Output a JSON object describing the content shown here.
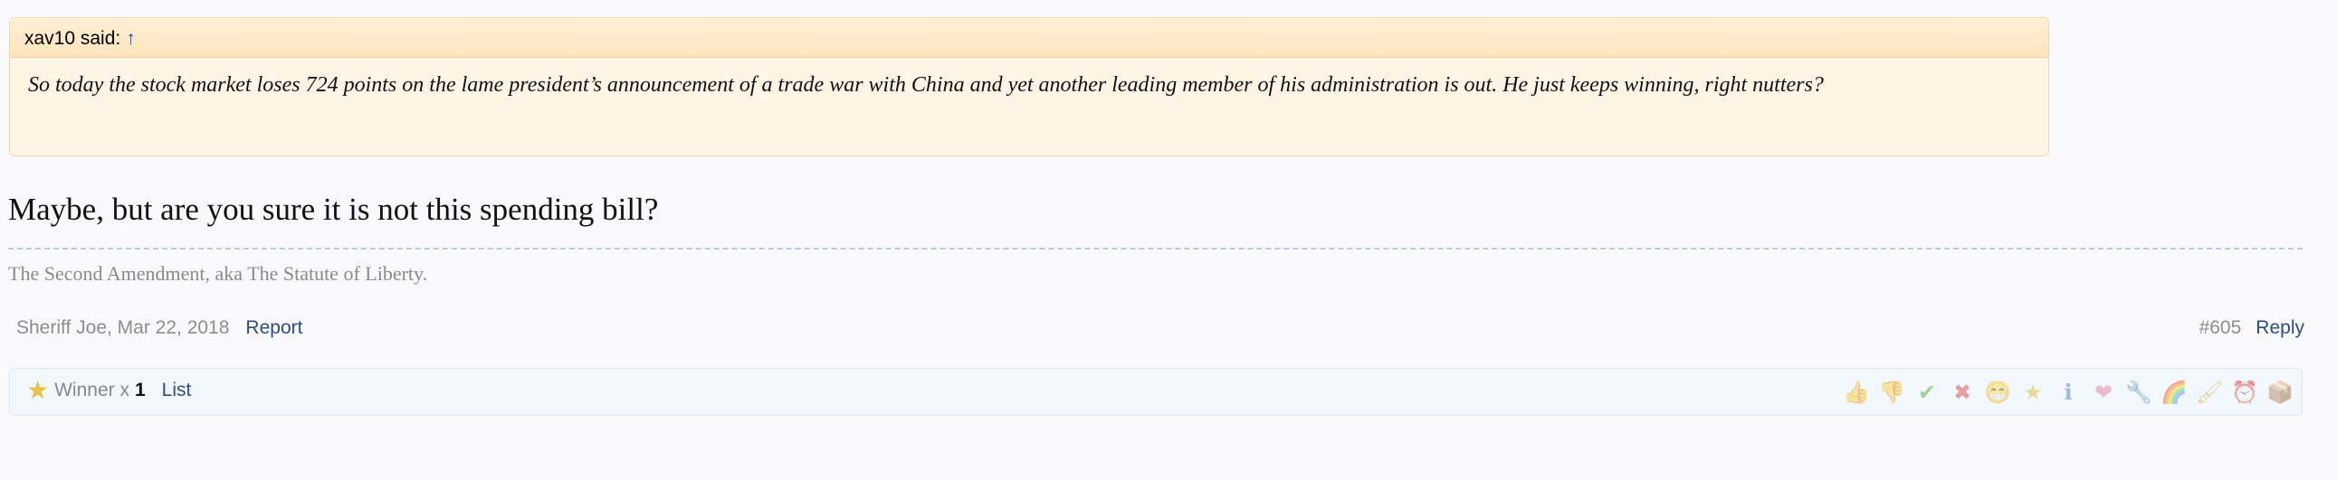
{
  "quote": {
    "author_label": "xav10 said:",
    "arrow": "↑",
    "text": "So today the stock market loses 724 points on the lame president’s announcement of a trade war with China and yet another leading member of his administration is out. He just keeps winning, right nutters?"
  },
  "post": {
    "body": "Maybe, but are you sure it is not this spending bill?",
    "signature": "The Second Amendment, aka The Statute of Liberty.",
    "author_date": "Sheriff Joe, Mar 22, 2018",
    "report_label": "Report",
    "post_number": "#605",
    "reply_label": "Reply"
  },
  "ratings": {
    "summary_label": "Winner x",
    "summary_count": "1",
    "list_label": "List",
    "icons": [
      {
        "name": "like-icon",
        "glyph": "👍",
        "color": "#c9a27a"
      },
      {
        "name": "dislike-icon",
        "glyph": "👎",
        "color": "#c9a27a"
      },
      {
        "name": "agree-icon",
        "glyph": "✔",
        "color": "#49a13a"
      },
      {
        "name": "disagree-icon",
        "glyph": "✖",
        "color": "#d9343b"
      },
      {
        "name": "funny-icon",
        "glyph": "😁",
        "color": "#e3b32f"
      },
      {
        "name": "winner-icon",
        "glyph": "★",
        "color": "#e3b32f"
      },
      {
        "name": "informative-icon",
        "glyph": "ℹ",
        "color": "#3d6fc4"
      },
      {
        "name": "friendly-icon",
        "glyph": "❤",
        "color": "#e8718d"
      },
      {
        "name": "useful-icon",
        "glyph": "🔧",
        "color": "#8a8fa0"
      },
      {
        "name": "optimistic-icon",
        "glyph": "🌈",
        "color": "#d96a6a"
      },
      {
        "name": "creative-icon",
        "glyph": "🖌",
        "color": "#d8a93a"
      },
      {
        "name": "late-icon",
        "glyph": "⏰",
        "color": "#d9463f"
      },
      {
        "name": "box-icon",
        "glyph": "📦",
        "color": "#b07a3c"
      }
    ]
  }
}
